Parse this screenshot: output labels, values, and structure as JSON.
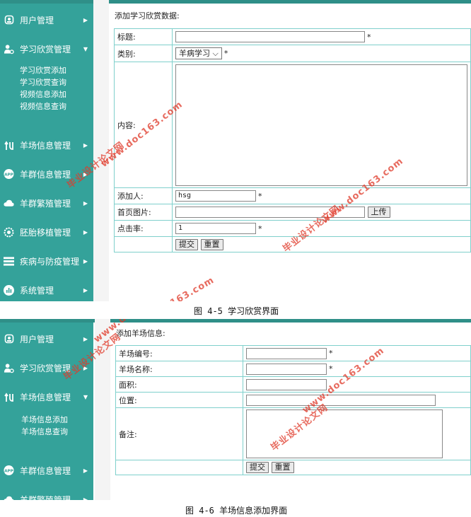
{
  "shot1": {
    "sidebar": {
      "items": [
        {
          "label": "用户管理",
          "icon": "user-icon"
        },
        {
          "label": "学习欣赏管理",
          "icon": "user-gear-icon"
        },
        {
          "label": "羊场信息管理",
          "icon": "route-icon"
        },
        {
          "label": "羊群信息管理",
          "icon": "app-badge-icon"
        },
        {
          "label": "羊群繁殖管理",
          "icon": "cloud-icon"
        },
        {
          "label": "胚胎移植管理",
          "icon": "settings-ring-icon"
        },
        {
          "label": "疾病与防疫管理",
          "icon": "stack-icon"
        },
        {
          "label": "系统管理",
          "icon": "bar-chart-icon"
        }
      ],
      "subitems": [
        "学习欣赏添加",
        "学习欣赏查询",
        "视频信息添加",
        "视频信息查询"
      ]
    },
    "form": {
      "heading": "添加学习欣赏数据:",
      "title_label": "标题:",
      "category_label": "类别:",
      "category_value": "羊病学习",
      "content_label": "内容:",
      "adder_label": "添加人:",
      "adder_value": "hsg",
      "image_label": "首页图片:",
      "upload_button": "上传",
      "clicks_label": "点击率:",
      "clicks_value": "1",
      "submit_button": "提交",
      "reset_button": "重置",
      "required_mark": "*"
    },
    "caption": "图 4-5  学习欣赏界面"
  },
  "shot2": {
    "sidebar": {
      "items": [
        {
          "label": "用户管理",
          "icon": "user-icon"
        },
        {
          "label": "学习欣赏管理",
          "icon": "user-gear-icon"
        },
        {
          "label": "羊场信息管理",
          "icon": "route-icon"
        },
        {
          "label": "羊群信息管理",
          "icon": "app-badge-icon"
        },
        {
          "label": "羊群繁殖管理",
          "icon": "cloud-icon"
        }
      ],
      "subitems": [
        "羊场信息添加",
        "羊场信息查询"
      ]
    },
    "form": {
      "heading": "添加羊场信息:",
      "id_label": "羊场编号:",
      "name_label": "羊场名称:",
      "area_label": "面积:",
      "location_label": "位置:",
      "notes_label": "备注:",
      "submit_button": "提交",
      "reset_button": "重置",
      "required_mark": "*"
    },
    "caption": "图 4-6  羊场信息添加界面"
  },
  "watermark": {
    "line1": "毕业设计论文网",
    "line2": "www.doc163.com"
  },
  "colors": {
    "sidebar": "#34a29a",
    "table_border": "#7fd0cc",
    "watermark": "#e03a2a"
  }
}
